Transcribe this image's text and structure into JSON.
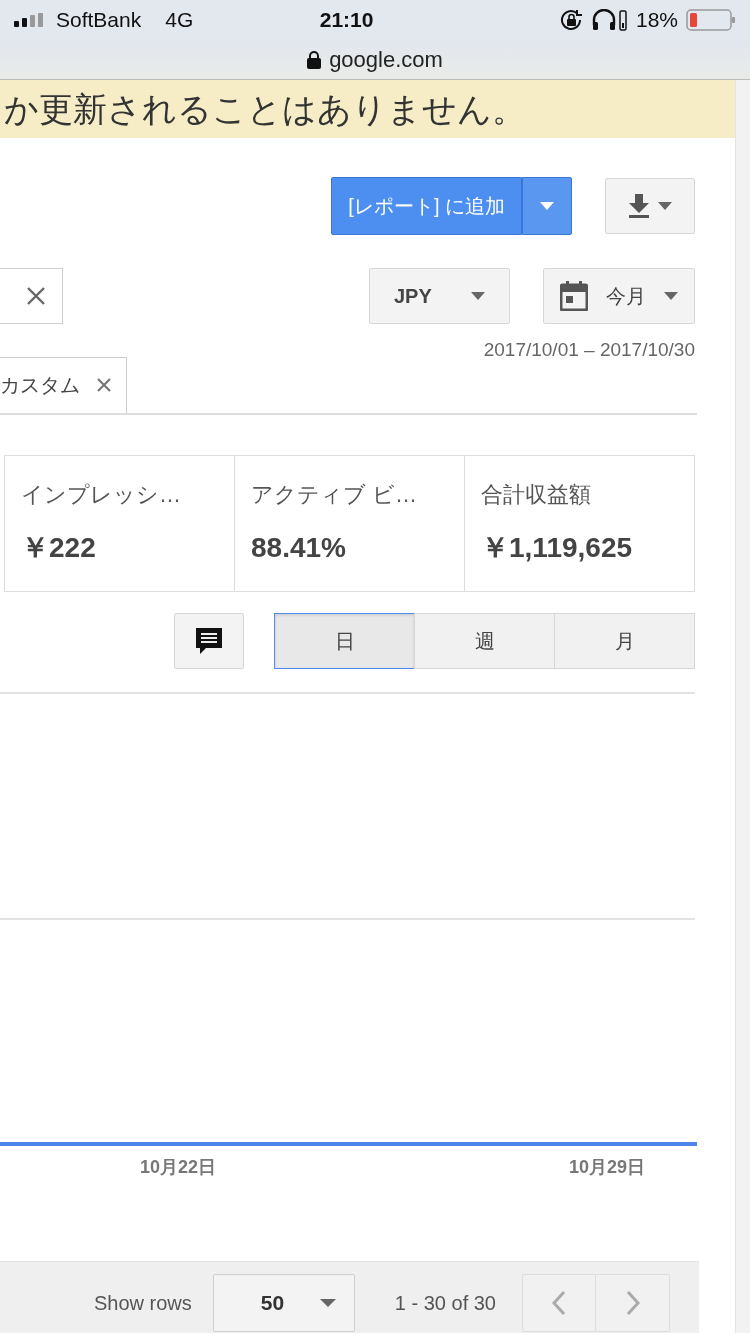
{
  "status_bar": {
    "carrier": "SoftBank",
    "network": "4G",
    "time": "21:10",
    "battery": "18%"
  },
  "address_bar": {
    "url": "google.com"
  },
  "notice": {
    "text": "か更新されることはありません。"
  },
  "toolbar": {
    "add_button": "[レポート] に追加"
  },
  "filters": {
    "currency": "JPY",
    "date_button": "今月",
    "date_range": "2017/10/01 – 2017/10/30"
  },
  "filter_chips": [
    {
      "label": "カスタム"
    }
  ],
  "metrics": [
    {
      "label": "インプレッシ…",
      "value": "￥222"
    },
    {
      "label": "アクティブ ビ…",
      "value": "88.41%"
    },
    {
      "label": "合計収益額",
      "value": "￥1,119,625"
    }
  ],
  "granularity": [
    {
      "label": "日",
      "selected": true
    },
    {
      "label": "週",
      "selected": false
    },
    {
      "label": "月",
      "selected": false
    }
  ],
  "chart": {
    "x_labels": [
      "10月22日",
      "10月29日"
    ]
  },
  "pagination": {
    "show_rows_label": "Show rows",
    "rows": "50",
    "range": "1 - 30 of 30"
  }
}
